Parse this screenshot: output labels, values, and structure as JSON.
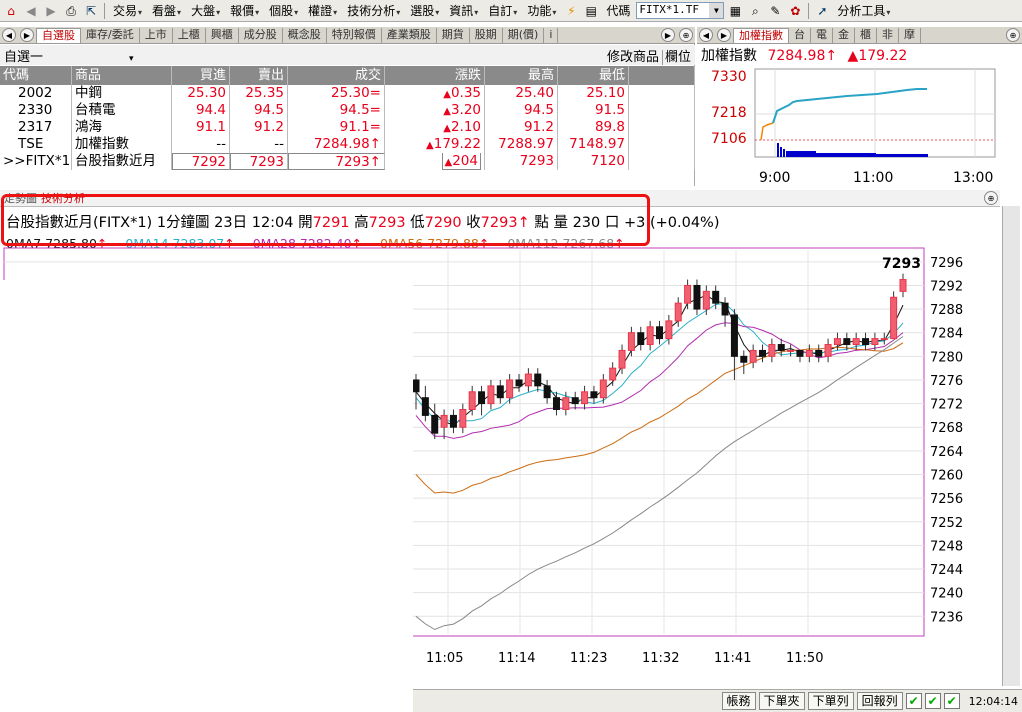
{
  "toolbar": {
    "menus": [
      "交易",
      "看盤",
      "大盤",
      "報價",
      "個股",
      "權證",
      "技術分析",
      "選股",
      "資訊",
      "自訂",
      "功能"
    ],
    "code_label": "代碼",
    "code_value": "FITX*1.TF",
    "tools_label": "分析工具"
  },
  "watch": {
    "tabs": [
      "自選股",
      "庫存/委託",
      "上市",
      "上櫃",
      "興櫃",
      "成分股",
      "概念股",
      "特別報價",
      "產業類股",
      "期貨",
      "股期",
      "期(價)",
      "i"
    ],
    "group_name": "自選一",
    "edit_label": "修改商品",
    "columns_label": "欄位",
    "headers": [
      "代碼",
      "商品",
      "買進",
      "賣出",
      "成交",
      "漲跌",
      "最高",
      "最低"
    ],
    "rows": [
      {
        "code": "2002",
        "name": "中鋼",
        "bid": "25.30",
        "ask": "25.35",
        "last": "25.30=",
        "chg": "0.35",
        "high": "25.40",
        "low": "25.10"
      },
      {
        "code": "2330",
        "name": "台積電",
        "bid": "94.4",
        "ask": "94.5",
        "last": "94.5=",
        "chg": "3.20",
        "high": "94.5",
        "low": "91.5"
      },
      {
        "code": "2317",
        "name": "鴻海",
        "bid": "91.1",
        "ask": "91.2",
        "last": "91.1=",
        "chg": "2.10",
        "high": "91.2",
        "low": "89.8"
      },
      {
        "code": "TSE",
        "name": "加權指數",
        "bid": "--",
        "ask": "--",
        "last": "7284.98↑",
        "chg": "179.22",
        "high": "7288.97",
        "low": "7148.97"
      },
      {
        "code": ">>FITX*1",
        "name": "台股指數近月",
        "bid": "7292",
        "ask": "7293",
        "last": "7293↑",
        "chg": "204",
        "high": "7293",
        "low": "7120"
      }
    ]
  },
  "index_panel": {
    "tabs": [
      "加權指數",
      "台",
      "電",
      "金",
      "櫃",
      "非",
      "摩"
    ],
    "name": "加權指數",
    "value": "7284.98",
    "change": "179.22",
    "y_labels": [
      "7330",
      "7218",
      "7106"
    ],
    "x_labels": [
      "9:00",
      "11:00",
      "13:00"
    ]
  },
  "chart": {
    "tabs": [
      "走勢圖",
      "技術分析"
    ],
    "info": {
      "name": "台股指數近月(FITX*1)",
      "period": "1分鐘圖",
      "date": "23日",
      "time": "12:04",
      "open_label": "開",
      "open": "7291",
      "high_label": "高",
      "high": "7293",
      "low_label": "低",
      "low": "7290",
      "close_label": "收",
      "close": "7293",
      "unit": "點",
      "volume_label": "量",
      "volume": "230",
      "vol_unit": "口",
      "change": "+3 (+0.04%)"
    },
    "ma": [
      {
        "label": "0MA7 7285.80",
        "color": "#111111"
      },
      {
        "label": "0MA14 7283.07",
        "color": "#2ab0c8"
      },
      {
        "label": "0MA28 7282.40",
        "color": "#b02cb0"
      },
      {
        "label": "0MA56 7279.88",
        "color": "#cc6a12"
      },
      {
        "label": "0MA112 7267.68",
        "color": "#888888"
      }
    ],
    "last_price_label": "7293",
    "y_ticks": [
      "7296",
      "7292",
      "7288",
      "7284",
      "7280",
      "7276",
      "7272",
      "7268",
      "7264",
      "7260",
      "7256",
      "7252",
      "7248",
      "7244",
      "7240",
      "7236"
    ],
    "x_ticks": [
      "11:05",
      "11:14",
      "11:23",
      "11:32",
      "11:41",
      "11:50"
    ]
  },
  "chart_data": {
    "type": "candlestick",
    "y_range": [
      7233,
      7298
    ],
    "candles": [
      [
        7276,
        7274,
        7277,
        7271
      ],
      [
        7273,
        7270,
        7275,
        7269
      ],
      [
        7270,
        7267,
        7272,
        7266
      ],
      [
        7268,
        7270,
        7271,
        7266
      ],
      [
        7270,
        7268,
        7271,
        7267
      ],
      [
        7268,
        7271,
        7272,
        7267
      ],
      [
        7271,
        7274,
        7275,
        7270
      ],
      [
        7274,
        7272,
        7275,
        7270
      ],
      [
        7272,
        7275,
        7276,
        7271
      ],
      [
        7275,
        7273,
        7276,
        7272
      ],
      [
        7273,
        7276,
        7277,
        7272
      ],
      [
        7276,
        7275,
        7277,
        7274
      ],
      [
        7275,
        7277,
        7278,
        7274
      ],
      [
        7277,
        7275,
        7278,
        7274
      ],
      [
        7275,
        7273,
        7276,
        7272
      ],
      [
        7273,
        7271,
        7274,
        7270
      ],
      [
        7271,
        7273,
        7274,
        7270
      ],
      [
        7273,
        7272,
        7274,
        7271
      ],
      [
        7272,
        7274,
        7275,
        7271
      ],
      [
        7274,
        7273,
        7275,
        7272
      ],
      [
        7273,
        7276,
        7277,
        7272
      ],
      [
        7276,
        7278,
        7279,
        7275
      ],
      [
        7278,
        7281,
        7282,
        7277
      ],
      [
        7281,
        7284,
        7285,
        7280
      ],
      [
        7284,
        7282,
        7285,
        7281
      ],
      [
        7282,
        7285,
        7286,
        7281
      ],
      [
        7285,
        7283,
        7286,
        7282
      ],
      [
        7283,
        7286,
        7287,
        7282
      ],
      [
        7286,
        7289,
        7290,
        7285
      ],
      [
        7289,
        7292,
        7293,
        7288
      ],
      [
        7292,
        7288,
        7293,
        7287
      ],
      [
        7288,
        7291,
        7292,
        7287
      ],
      [
        7291,
        7289,
        7292,
        7288
      ],
      [
        7289,
        7287,
        7290,
        7285
      ],
      [
        7287,
        7280,
        7288,
        7276
      ],
      [
        7280,
        7279,
        7281,
        7277
      ],
      [
        7279,
        7281,
        7282,
        7278
      ],
      [
        7281,
        7280,
        7282,
        7279
      ],
      [
        7280,
        7282,
        7283,
        7279
      ],
      [
        7282,
        7281,
        7283,
        7280
      ],
      [
        7281,
        7281,
        7282,
        7280
      ],
      [
        7281,
        7280,
        7281,
        7279
      ],
      [
        7280,
        7281,
        7282,
        7279
      ],
      [
        7281,
        7280,
        7282,
        7279
      ],
      [
        7280,
        7282,
        7283,
        7279
      ],
      [
        7282,
        7283,
        7284,
        7281
      ],
      [
        7283,
        7282,
        7284,
        7281
      ],
      [
        7282,
        7283,
        7284,
        7281
      ],
      [
        7283,
        7282,
        7284,
        7281
      ],
      [
        7282,
        7283,
        7284,
        7281
      ],
      [
        7283,
        7283,
        7284,
        7282
      ],
      [
        7283,
        7290,
        7291,
        7283
      ],
      [
        7291,
        7293,
        7294,
        7290
      ]
    ]
  },
  "status": {
    "buttons": [
      "帳務",
      "下單夾",
      "下單列",
      "回報列"
    ],
    "time": "12:04:14"
  }
}
